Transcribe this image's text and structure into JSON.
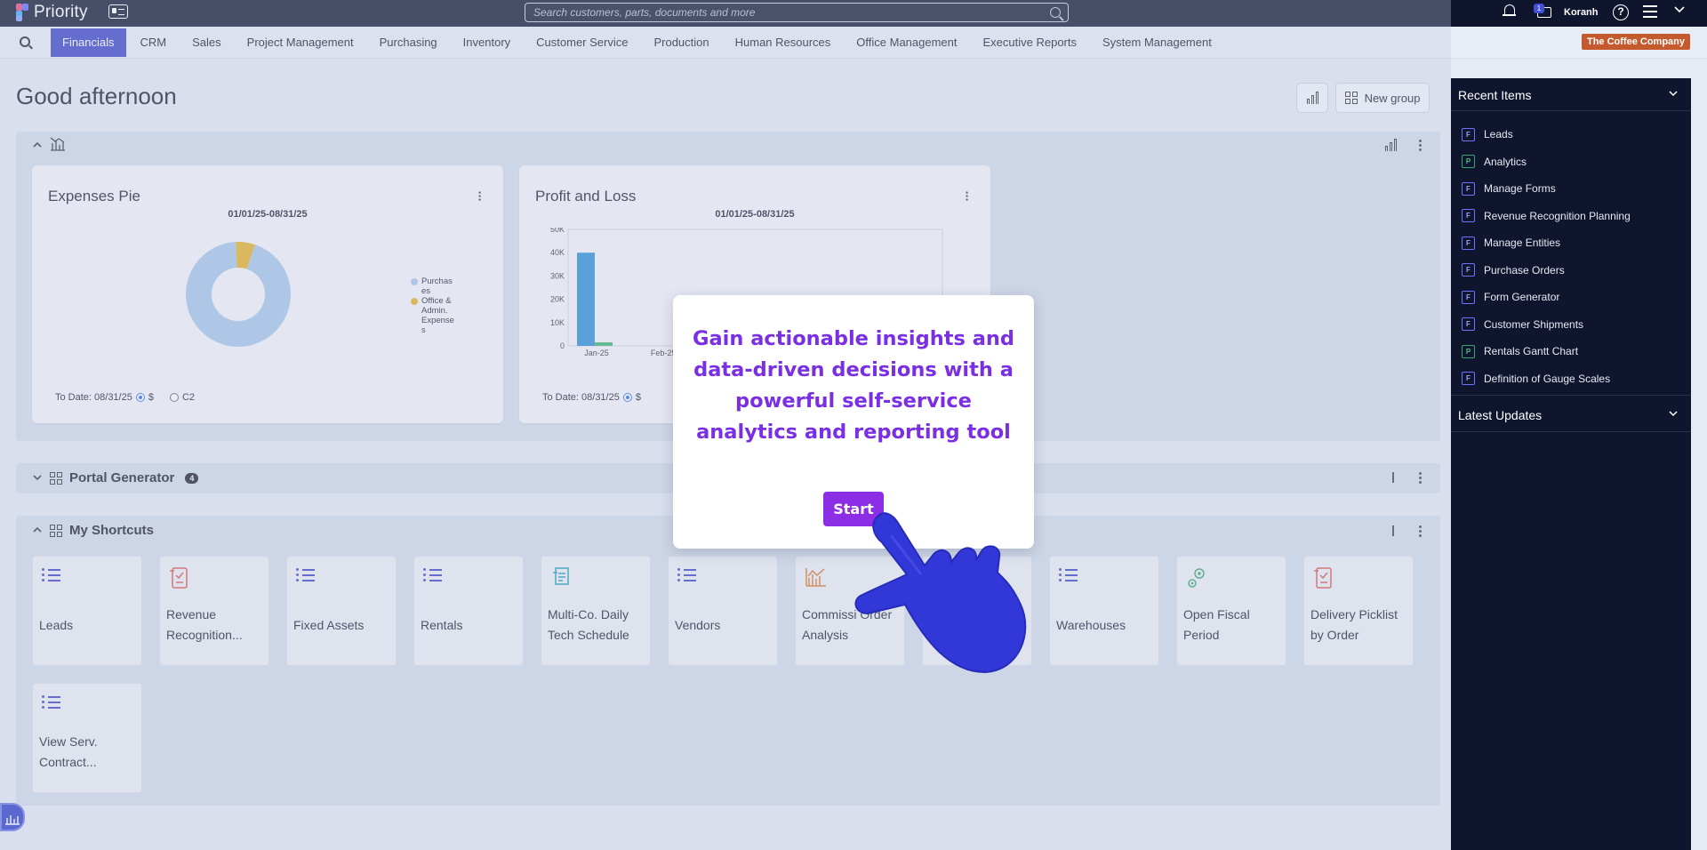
{
  "topbar": {
    "app_name": "Priority",
    "search_placeholder": "Search customers, parts, documents and more",
    "messages_count": "1",
    "user": "Koranh",
    "help_glyph": "?"
  },
  "nav": {
    "modules": [
      "Financials",
      "CRM",
      "Sales",
      "Project Management",
      "Purchasing",
      "Inventory",
      "Customer Service",
      "Production",
      "Human Resources",
      "Office Management",
      "Executive Reports",
      "System Management"
    ],
    "active": "Financials",
    "company": "The Coffee Company"
  },
  "main": {
    "greeting": "Good afternoon",
    "new_group_label": "New group"
  },
  "panels": {
    "portal_title": "Portal Generator",
    "portal_count": "4",
    "shortcuts_title": "My Shortcuts"
  },
  "cards": {
    "expenses": {
      "title": "Expenses Pie",
      "daterange": "01/01/25-08/31/25",
      "todate": "To Date: 08/31/25",
      "opt1": "$",
      "opt2": "C2"
    },
    "pl": {
      "title": "Profit and Loss",
      "daterange": "01/01/25-08/31/25",
      "todate": "To Date: 08/31/25",
      "opt1": "$"
    }
  },
  "chart_data": [
    {
      "type": "pie",
      "title": "Expenses Pie",
      "labels": [
        "Purchases",
        "Office & Admin. Expenses"
      ],
      "legend_text": [
        "Purchas es",
        "Office & Admin. Expense s"
      ],
      "values": [
        94,
        6
      ],
      "colors": [
        "#a9c8ea",
        "#e8b223"
      ],
      "donut": true,
      "legend": "right"
    },
    {
      "type": "bar",
      "title": "Profit and Loss",
      "categories": [
        "Jan-25",
        "Feb-25"
      ],
      "series": [
        {
          "values": [
            40000,
            0
          ],
          "color": "#2b8fd6"
        },
        {
          "values": [
            1500,
            0
          ],
          "color": "#39b36a"
        }
      ],
      "yticks": [
        "0",
        "10K",
        "20K",
        "30K",
        "40K",
        "50K"
      ],
      "ylim": [
        0,
        50000
      ]
    }
  ],
  "shortcuts": [
    {
      "label": "Leads",
      "icon": "list-icon"
    },
    {
      "label": "Revenue Recognition...",
      "icon": "report-icon"
    },
    {
      "label": "Fixed Assets",
      "icon": "list-icon"
    },
    {
      "label": "Rentals",
      "icon": "list-icon"
    },
    {
      "label": "Multi-Co. Daily Tech Schedule",
      "icon": "schedule-icon"
    },
    {
      "label": "Vendors",
      "icon": "list-icon"
    },
    {
      "label": "Commissi Order Analysis",
      "icon": "chart-icon"
    },
    {
      "label": "",
      "icon": ""
    },
    {
      "label": "Warehouses",
      "icon": "list-icon"
    },
    {
      "label": "Open Fiscal Period",
      "icon": "gears-icon"
    },
    {
      "label": "Delivery Picklist by Order",
      "icon": "report-icon"
    },
    {
      "label": "View Serv. Contract...",
      "icon": "list-icon"
    }
  ],
  "sidebar": {
    "recent_title": "Recent Items",
    "latest_title": "Latest Updates",
    "items": [
      {
        "label": "Leads",
        "type": "F"
      },
      {
        "label": "Analytics",
        "type": "P"
      },
      {
        "label": "Manage Forms",
        "type": "F"
      },
      {
        "label": "Revenue Recognition Planning",
        "type": "F"
      },
      {
        "label": "Manage Entities",
        "type": "F"
      },
      {
        "label": "Purchase Orders",
        "type": "F"
      },
      {
        "label": "Form Generator",
        "type": "F"
      },
      {
        "label": "Customer Shipments",
        "type": "F"
      },
      {
        "label": "Rentals Gantt Chart",
        "type": "P"
      },
      {
        "label": "Definition of Gauge Scales",
        "type": "F"
      }
    ]
  },
  "modal": {
    "text": "Gain actionable insights and data-driven decisions with a powerful self-service analytics and reporting tool",
    "start_label": "Start"
  },
  "colors": {
    "accent": "#3b43c8",
    "modal_text": "#7b2fe3",
    "start": "#8c2ee6",
    "company_badge": "#c65a2f",
    "sidebar_bg": "#10152e"
  }
}
